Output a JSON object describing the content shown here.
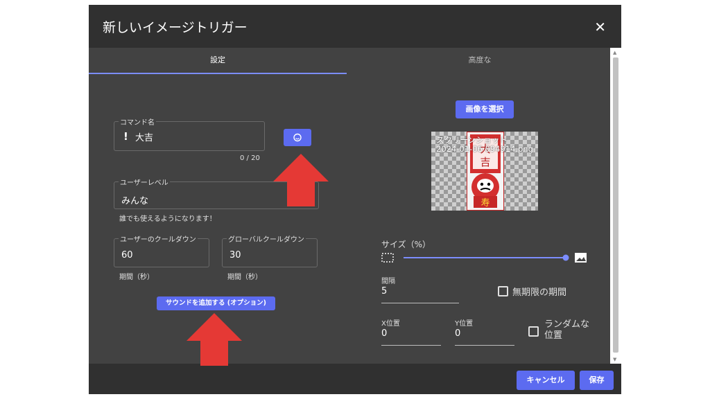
{
  "dialog": {
    "title": "新しいイメージトリガー",
    "close_label": "✕"
  },
  "tabs": [
    {
      "label": "設定",
      "active": true
    },
    {
      "label": "高度な",
      "active": false
    }
  ],
  "settings": {
    "command_name": {
      "label": "コマンド名",
      "prefix": "!",
      "value": "大吉",
      "counter": "0 / 20"
    },
    "user_level": {
      "label": "ユーザーレベル",
      "value": "みんな",
      "hint": "誰でも使えるようになります！"
    },
    "user_cooldown": {
      "label": "ユーザーのクールダウン",
      "value": "60",
      "hint": "期間（秒）"
    },
    "global_cooldown": {
      "label": "グローバルクールダウン",
      "value": "30",
      "hint": "期間（秒）"
    },
    "add_sound_button": "サウンドを追加する (オプション)"
  },
  "image": {
    "select_button": "画像を選択",
    "filename_line1": "スクリーンショット",
    "filename_line2": "2024-01-06 094914.png",
    "size_label": "サイズ（%）",
    "size_value": 1.0,
    "interval_label": "間隔",
    "interval_value": "5",
    "unlimited_label": "無期限の期間",
    "x_label": "X位置",
    "x_value": "0",
    "y_label": "Y位置",
    "y_value": "0",
    "random_label_line1": "ランダムな",
    "random_label_line2": "位置"
  },
  "footer": {
    "cancel": "キャンセル",
    "save": "保存"
  },
  "colors": {
    "accent": "#5c6bf0",
    "arrow": "#e53935",
    "dialog_bg": "#424242",
    "header_bg": "#303030"
  }
}
